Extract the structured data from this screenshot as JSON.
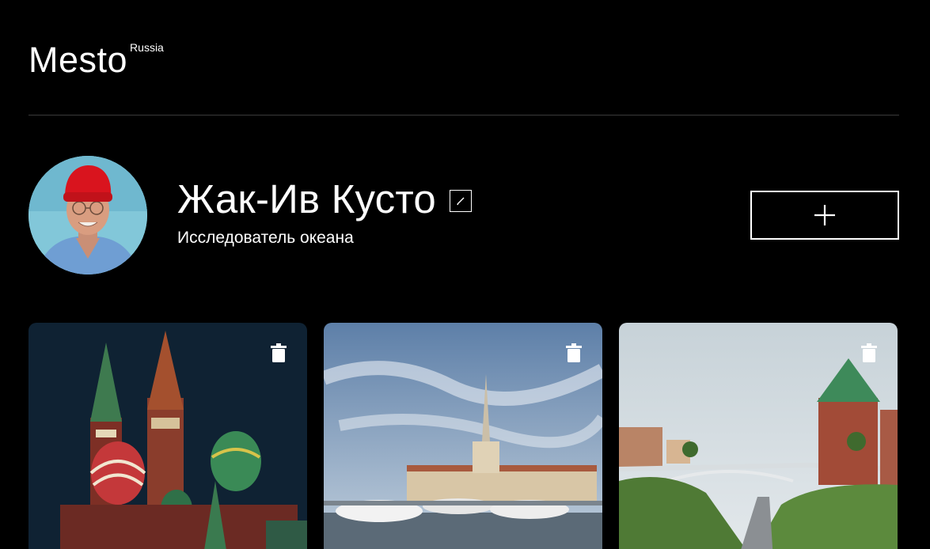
{
  "header": {
    "logo_text": "Mesto",
    "logo_sup": "Russia"
  },
  "profile": {
    "name": "Жак-Ив Кусто",
    "about": "Исследователь океана"
  },
  "cards": [
    {
      "subject": "Moscow Saint Basil's Cathedral at night"
    },
    {
      "subject": "Sochi sea port with yachts"
    },
    {
      "subject": "Nizhny Novgorod kremlin road"
    }
  ],
  "colors": {
    "background": "#000000",
    "text": "#ffffff",
    "divider": "#545454"
  }
}
